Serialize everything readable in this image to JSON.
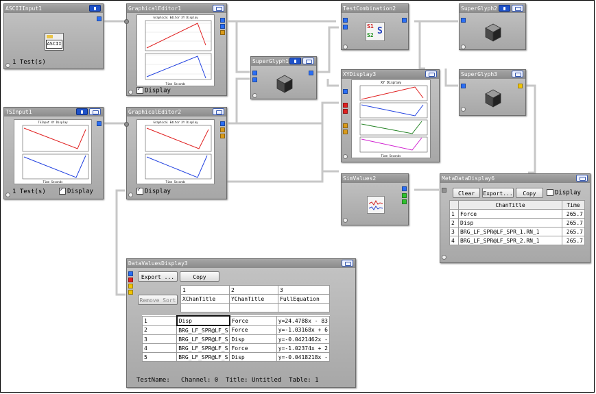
{
  "nodes": {
    "ascii_input": {
      "title": "ASCIIInput1",
      "icon_label": "ASCII",
      "status": "1 Test(s)"
    },
    "graphical_editor1": {
      "title": "GraphicalEditor1",
      "plot_title": "Graphical Editor XY Display",
      "x_label": "Time Seconds",
      "display_label": "Display",
      "display_checked": true
    },
    "ts_input": {
      "title": "TSInput1",
      "plot_title": "TSInput XY Display",
      "x_label": "Time Seconds",
      "status": "1 Test(s)",
      "display_label": "Display",
      "display_checked": true
    },
    "graphical_editor2": {
      "title": "GraphicalEditor2",
      "plot_title": "Graphical Editor XY Display",
      "x_label": "Time Seconds",
      "display_label": "Display",
      "display_checked": true
    },
    "superglyph1": {
      "title": "SuperGlyph1"
    },
    "test_combination": {
      "title": "TestCombination2",
      "label_s1": "S1",
      "label_s2": "S2"
    },
    "superglyph2": {
      "title": "SuperGlyph2"
    },
    "superglyph3": {
      "title": "SuperGlyph3"
    },
    "xy_display": {
      "title": "XYDisplay3",
      "plot_title": "XY Display",
      "x_label": "Time Seconds"
    },
    "sim_values": {
      "title": "SimValues2"
    },
    "metadata_display": {
      "title": "MetaDataDisplay6",
      "clear_label": "Clear",
      "export_label": "Export...",
      "copy_label": "Copy",
      "display_label": "Display",
      "display_checked": false,
      "columns": [
        "",
        "ChanTitle",
        "Time"
      ],
      "rows": [
        [
          "1",
          "Force",
          "265.7"
        ],
        [
          "2",
          "Disp",
          "265.7"
        ],
        [
          "3",
          "BRG_LF_SPR@LF_SPR_1.RN_1",
          "265.7"
        ],
        [
          "4",
          "BRG_LF_SPR@LF_SPR_2.RN_1",
          "265.7"
        ]
      ]
    },
    "data_values_display": {
      "title": "DataValuesDisplay3",
      "export_label": "Export ...",
      "copy_label": "Copy",
      "remove_sort_label": "Remove Sort",
      "col_numbers": [
        "1",
        "2",
        "3"
      ],
      "col_titles": [
        "XChanTitle",
        "YChanTitle",
        "FullEquation"
      ],
      "rows": [
        [
          "1",
          "Disp",
          "Force",
          "y=24.4788x - 83"
        ],
        [
          "2",
          "BRG_LF_SPR@LF_S",
          "Force",
          "y=-1.03168x + 6"
        ],
        [
          "3",
          "BRG_LF_SPR@LF_S",
          "Disp",
          "y=-0.0421462x -"
        ],
        [
          "4",
          "BRG_LF_SPR@LF_S",
          "Force",
          "y=-1.02374x + 2"
        ],
        [
          "5",
          "BRG_LF_SPR@LF_S",
          "Disp",
          "y=-0.0418218x -"
        ]
      ],
      "status": "TestName:   Channel: 0  Title: Untitled  Table: 1"
    }
  },
  "colors": {
    "port_blue": "#2a6ef5",
    "port_red": "#e02020",
    "port_green": "#2ec02e",
    "port_yellow": "#f2c400",
    "port_orange": "#d99a1a",
    "wire": "#c7c7c7"
  },
  "icons": [
    "ascii-file-icon",
    "cube-icon",
    "test-combination-icon",
    "sim-values-icon",
    "lock-button-icon",
    "maximize-icon"
  ]
}
